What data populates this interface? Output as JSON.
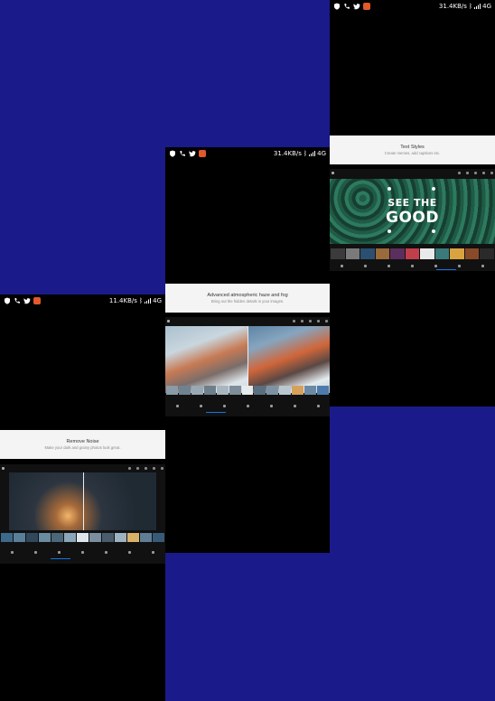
{
  "colors": {
    "background": "#1a1a8a",
    "accent": "#1473e6",
    "instagram": "#e2592b"
  },
  "screens": [
    {
      "name": "remove-noise",
      "status": {
        "speed": "11.4KB/s",
        "network": "4G",
        "lte": "LTE"
      },
      "feature": {
        "title": "Remove Noise",
        "subtitle": "Make your dark and grainy photos look great."
      }
    },
    {
      "name": "haze",
      "status": {
        "speed": "31.4KB/s",
        "network": "4G",
        "lte": "LTE"
      },
      "feature": {
        "title": "Advanced atmospheric haze and fog",
        "subtitle": "Bring out the hidden details in your images."
      }
    },
    {
      "name": "text-styles",
      "status": {
        "speed": "31.4KB/s",
        "network": "4G",
        "lte": "LTE"
      },
      "feature": {
        "title": "Text Styles",
        "subtitle": "Create memes, add captions etc."
      },
      "poster": {
        "line1": "SEE THE",
        "line2": "GOOD"
      }
    }
  ]
}
